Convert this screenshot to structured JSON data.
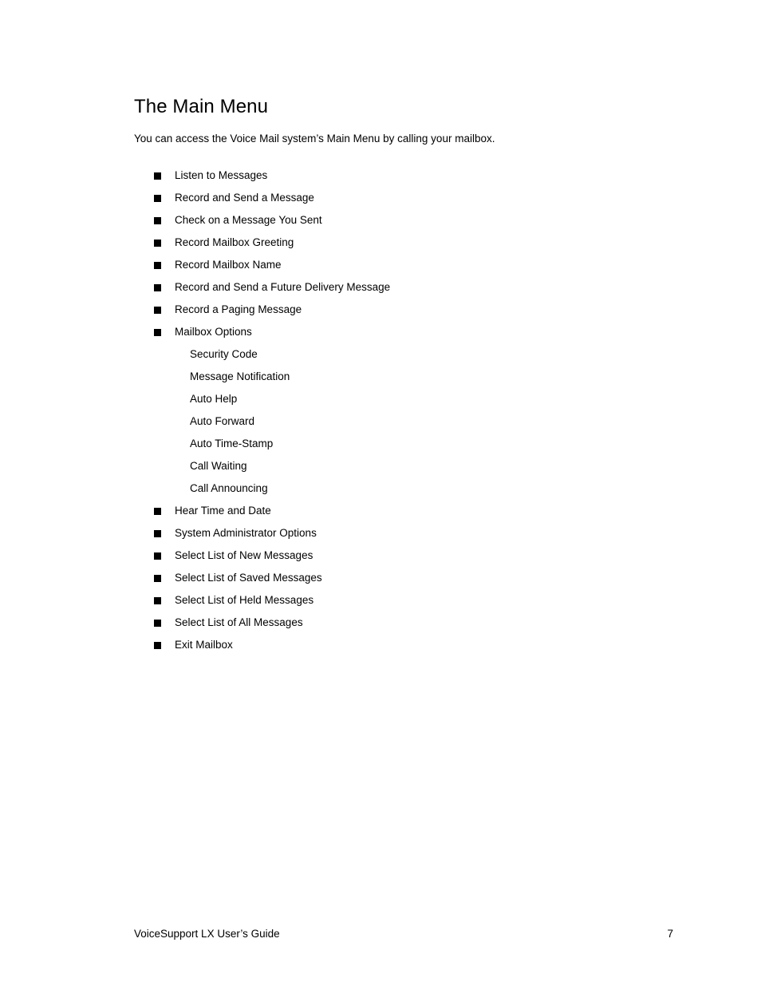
{
  "document": {
    "heading": "The Main Menu",
    "intro": "You can access the Voice Mail system’s Main Menu by calling your mailbox.",
    "menu_items": [
      {
        "label": "Listen to Messages",
        "level": 0,
        "bullet": "filled-square"
      },
      {
        "label": "Record and Send a Message",
        "level": 0,
        "bullet": "filled-square"
      },
      {
        "label": "Check on a Message You Sent",
        "level": 0,
        "bullet": "filled-square"
      },
      {
        "label": "Record Mailbox Greeting",
        "level": 0,
        "bullet": "filled-square"
      },
      {
        "label": "Record Mailbox Name",
        "level": 0,
        "bullet": "filled-square"
      },
      {
        "label": "Record and Send a Future Delivery Message",
        "level": 0,
        "bullet": "filled-square"
      },
      {
        "label": "Record a Paging Message",
        "level": 0,
        "bullet": "filled-square"
      },
      {
        "label": "Mailbox Options",
        "level": 0,
        "bullet": "filled-square"
      },
      {
        "label": "Security Code",
        "level": 1,
        "bullet": "none"
      },
      {
        "label": "Message Notification",
        "level": 1,
        "bullet": "none"
      },
      {
        "label": "Auto Help",
        "level": 1,
        "bullet": "none"
      },
      {
        "label": "Auto Forward",
        "level": 1,
        "bullet": "none"
      },
      {
        "label": "Auto Time-Stamp",
        "level": 1,
        "bullet": "none"
      },
      {
        "label": "Call Waiting",
        "level": 1,
        "bullet": "none"
      },
      {
        "label": "Call Announcing",
        "level": 1,
        "bullet": "none"
      },
      {
        "label": "Hear Time and Date",
        "level": 0,
        "bullet": "filled-square"
      },
      {
        "label": "System Administrator Options",
        "level": 0,
        "bullet": "filled-square"
      },
      {
        "label": "Select List of New Messages",
        "level": 0,
        "bullet": "filled-square"
      },
      {
        "label": "Select List of Saved Messages",
        "level": 0,
        "bullet": "filled-square"
      },
      {
        "label": "Select List of Held Messages",
        "level": 0,
        "bullet": "filled-square"
      },
      {
        "label": "Select List of All Messages",
        "level": 0,
        "bullet": "filled-square"
      },
      {
        "label": "Exit Mailbox",
        "level": 0,
        "bullet": "filled-square"
      }
    ]
  },
  "footer": {
    "title": "VoiceSupport LX User’s Guide",
    "page_number": "7"
  },
  "colors": {
    "page_background": "#ffffff",
    "text": "#000000",
    "bullet": "#000000"
  }
}
